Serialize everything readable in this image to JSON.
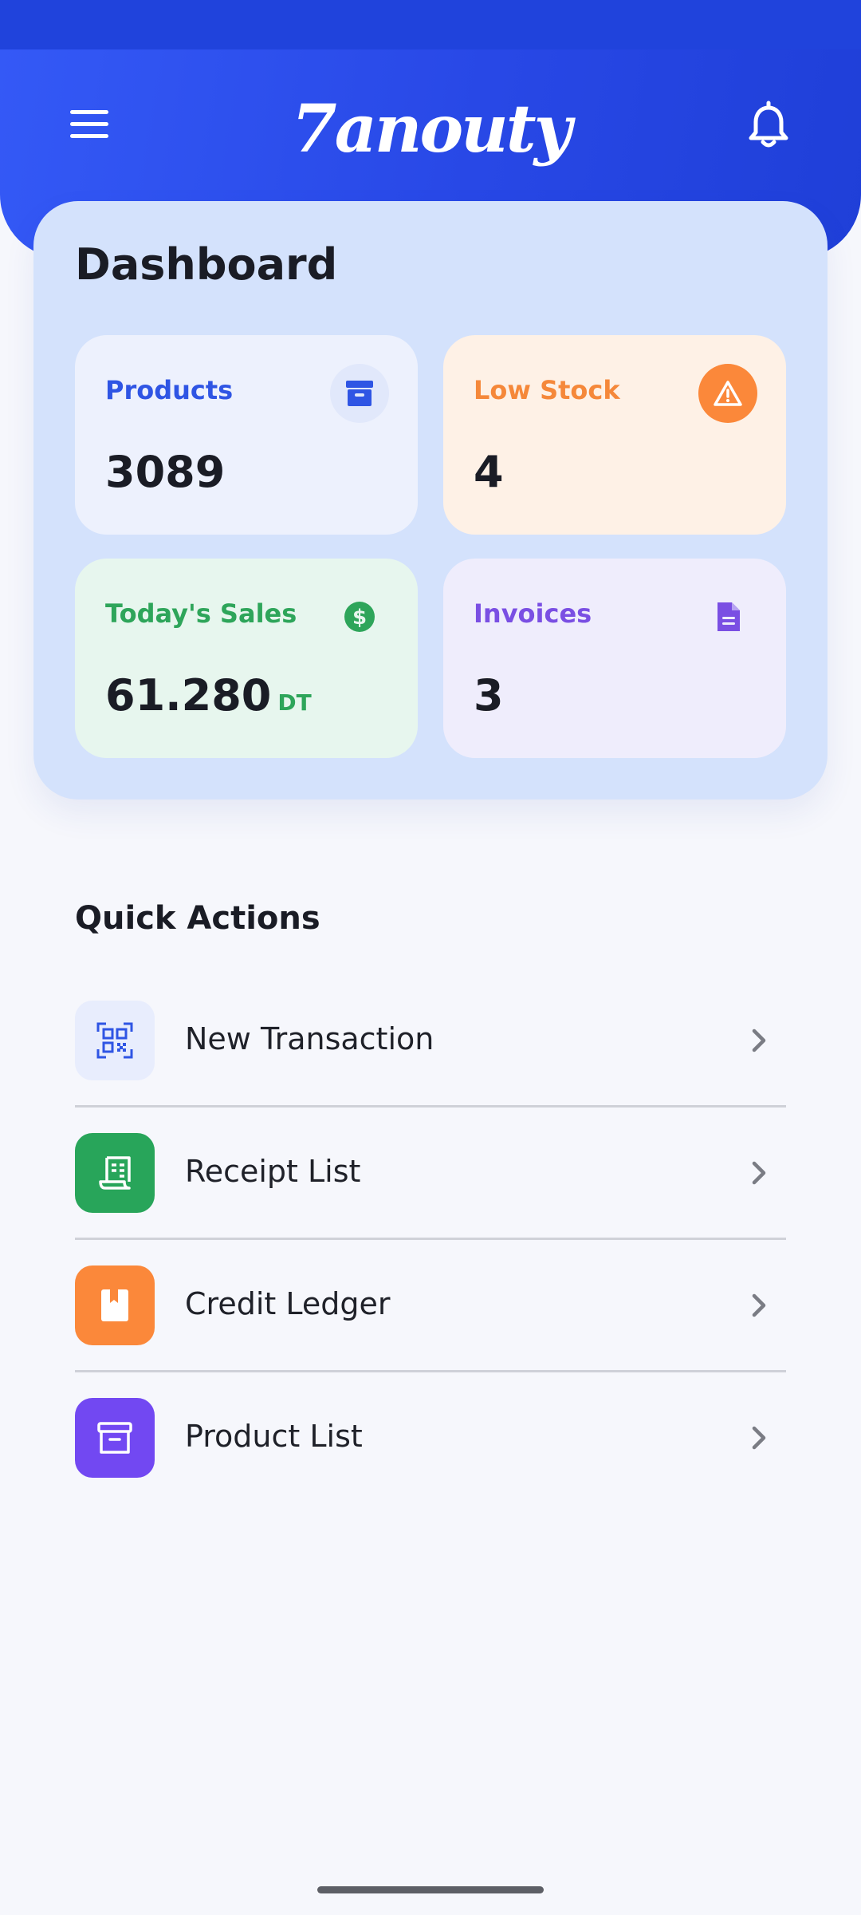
{
  "app": {
    "logo_text": "7anouty"
  },
  "header": {
    "menu_icon": "hamburger-menu-icon",
    "notifications_icon": "bell-icon"
  },
  "dashboard": {
    "title": "Dashboard",
    "stats": [
      {
        "label": "Products",
        "value": "3089",
        "unit": "",
        "icon": "archive-box-icon",
        "color": "#2f55e4"
      },
      {
        "label": "Low Stock",
        "value": "4",
        "unit": "",
        "icon": "warning-triangle-icon",
        "color": "#f5883a"
      },
      {
        "label": "Today's Sales",
        "value": "61.280",
        "unit": "DT",
        "icon": "dollar-coin-icon",
        "color": "#2ea55a"
      },
      {
        "label": "Invoices",
        "value": "3",
        "unit": "",
        "icon": "document-icon",
        "color": "#7a4fe3"
      }
    ]
  },
  "quick_actions": {
    "title": "Quick Actions",
    "items": [
      {
        "label": "New Transaction",
        "icon": "qr-code-scan-icon",
        "color": "#e8edfd"
      },
      {
        "label": "Receipt List",
        "icon": "receipt-icon",
        "color": "#28a55a"
      },
      {
        "label": "Credit Ledger",
        "icon": "ledger-book-icon",
        "color": "#fb883a"
      },
      {
        "label": "Product List",
        "icon": "archive-box-icon",
        "color": "#7248f2"
      }
    ]
  }
}
